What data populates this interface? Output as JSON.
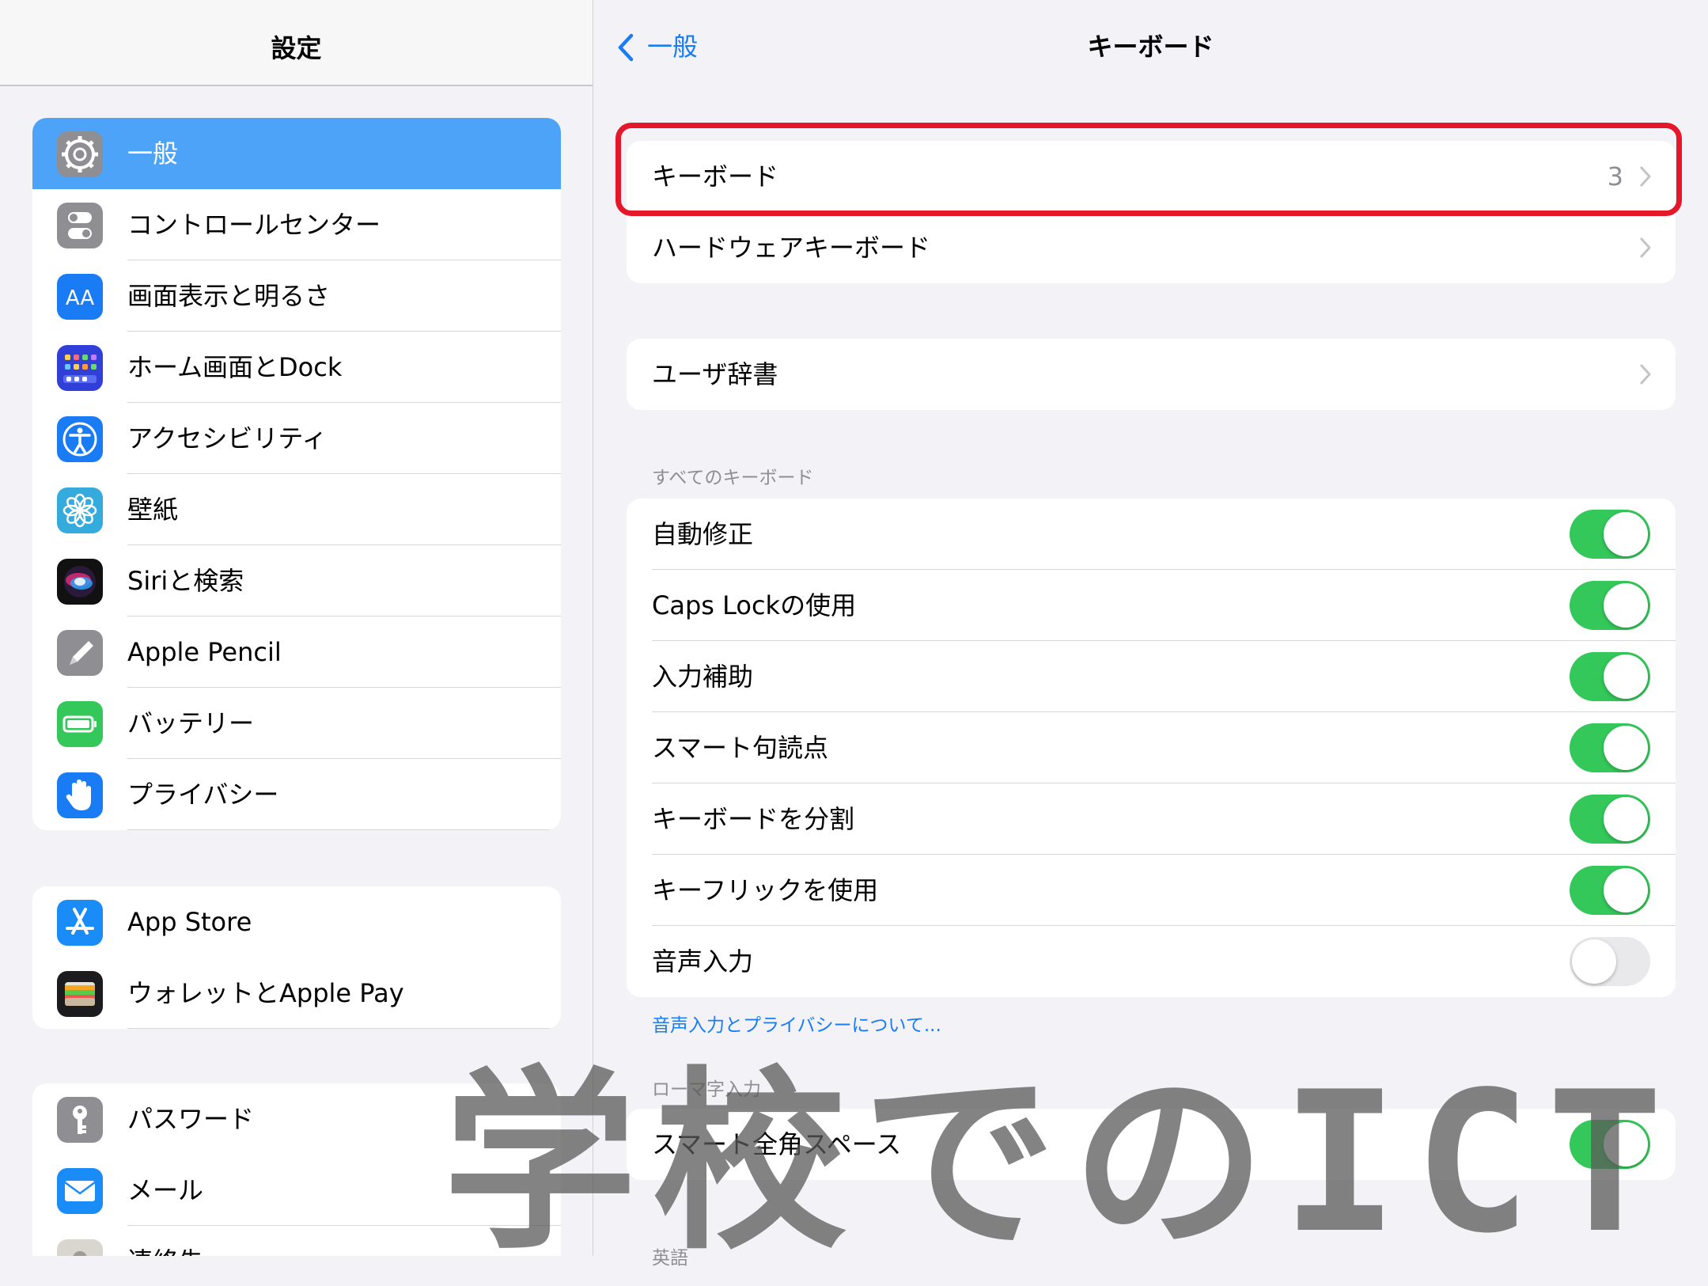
{
  "sidebar": {
    "title": "設定",
    "groups": [
      [
        {
          "label": "一般",
          "icon": "gear-icon",
          "selected": true
        },
        {
          "label": "コントロールセンター",
          "icon": "switches-icon"
        },
        {
          "label": "画面表示と明るさ",
          "icon": "text-size-icon",
          "icon_text": "AA"
        },
        {
          "label": "ホーム画面とDock",
          "icon": "home-screen-grid-icon"
        },
        {
          "label": "アクセシビリティ",
          "icon": "accessibility-icon"
        },
        {
          "label": "壁紙",
          "icon": "flower-icon"
        },
        {
          "label": "Siriと検索",
          "icon": "siri-icon"
        },
        {
          "label": "Apple Pencil",
          "icon": "pencil-icon"
        },
        {
          "label": "バッテリー",
          "icon": "battery-icon"
        },
        {
          "label": "プライバシー",
          "icon": "hand-icon"
        }
      ],
      [
        {
          "label": "App Store",
          "icon": "app-store-icon"
        },
        {
          "label": "ウォレットとApple Pay",
          "icon": "wallet-icon"
        }
      ],
      [
        {
          "label": "パスワード",
          "icon": "key-icon"
        },
        {
          "label": "メール",
          "icon": "mail-icon"
        },
        {
          "label": "連絡先",
          "icon": "contacts-icon"
        }
      ]
    ]
  },
  "detail": {
    "back_label": "一般",
    "title": "キーボード",
    "group1": [
      {
        "label": "キーボード",
        "value": "3"
      },
      {
        "label": "ハードウェアキーボード"
      }
    ],
    "group2": [
      {
        "label": "ユーザ辞書"
      }
    ],
    "section_all": "すべてのキーボード",
    "toggles": [
      {
        "label": "自動修正",
        "on": true
      },
      {
        "label": "Caps Lockの使用",
        "on": true
      },
      {
        "label": "入力補助",
        "on": true
      },
      {
        "label": "スマート句読点",
        "on": true
      },
      {
        "label": "キーボードを分割",
        "on": true
      },
      {
        "label": "キーフリックを使用",
        "on": true
      },
      {
        "label": "音声入力",
        "on": false
      }
    ],
    "privacy_link": "音声入力とプライバシーについて...",
    "section_romaji": "ローマ字入力",
    "romaji_toggles": [
      {
        "label": "スマート全角スペース",
        "on": true
      }
    ],
    "section_english": "英語"
  },
  "watermark": "学校でのICT",
  "colors": {
    "accent": "#1a7cf5",
    "selected": "#4da3f7",
    "toggle_on": "#34c759",
    "highlight": "#e5172b"
  }
}
